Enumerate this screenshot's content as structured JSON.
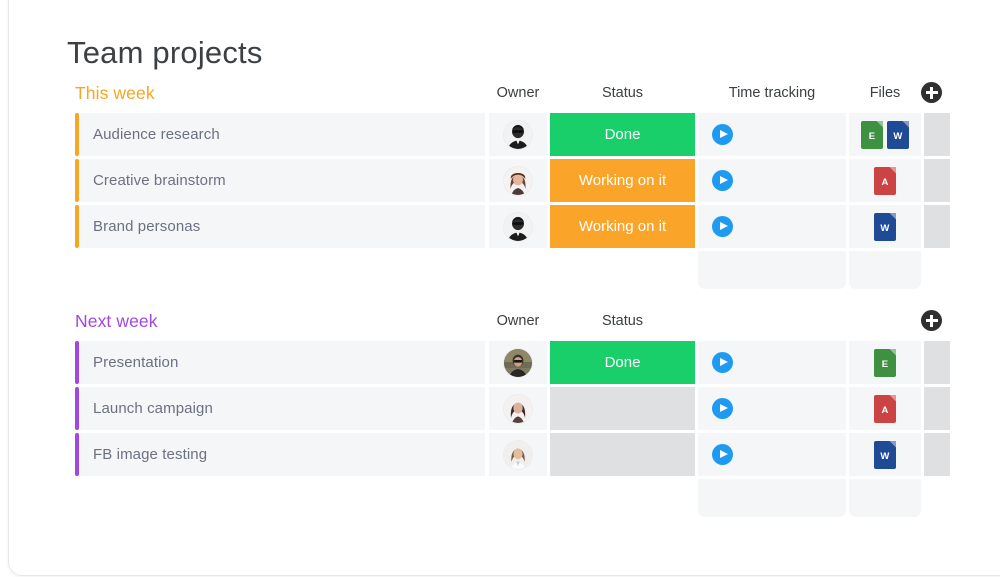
{
  "page": {
    "title": "Team projects"
  },
  "icons": {
    "add": "plus-circle-icon",
    "play": "play-icon"
  },
  "colors": {
    "this_week_accent": "#f5a623",
    "next_week_accent": "#a446e0",
    "status_done": "#19cf6a",
    "status_working": "#fba42a",
    "status_empty": "#dfe0e2",
    "play_blue": "#1e9bf0",
    "file_excel": "#3f9142",
    "file_word": "#1f4b96",
    "file_acrobat": "#cc4343",
    "task_text": "#6b7184",
    "title_text": "#3c4043"
  },
  "columns": {
    "owner": "Owner",
    "status": "Status",
    "time_tracking": "Time tracking",
    "files": "Files"
  },
  "sections": [
    {
      "title": "This week",
      "accent": "#f5a623",
      "show_time_header": true,
      "show_files_header": true,
      "rows": [
        {
          "name": "Audience research",
          "owner": "man-with-sunglasses-avatar",
          "status": "Done",
          "status_color": "#19cf6a",
          "time_tracking": "play-icon",
          "files": [
            {
              "label": "E",
              "type": "excel",
              "color": "#3f9142"
            },
            {
              "label": "W",
              "type": "word",
              "color": "#1f4b96"
            }
          ]
        },
        {
          "name": "Creative brainstorm",
          "owner": "woman-brown-hair-avatar",
          "status": "Working on it",
          "status_color": "#fba42a",
          "time_tracking": "play-icon",
          "files": [
            {
              "label": "A",
              "type": "acrobat",
              "color": "#cc4343"
            }
          ]
        },
        {
          "name": "Brand personas",
          "owner": "man-with-sunglasses-avatar",
          "status": "Working on it",
          "status_color": "#fba42a",
          "time_tracking": "play-icon",
          "files": [
            {
              "label": "W",
              "type": "word",
              "color": "#1f4b96"
            }
          ]
        }
      ],
      "summary": {
        "time_tracking": "",
        "files": ""
      }
    },
    {
      "title": "Next week",
      "accent": "#a446e0",
      "show_time_header": false,
      "show_files_header": false,
      "rows": [
        {
          "name": "Presentation",
          "owner": "person-sunglasses-outdoor-avatar",
          "status": "Done",
          "status_color": "#19cf6a",
          "time_tracking": "play-icon",
          "files": [
            {
              "label": "E",
              "type": "excel",
              "color": "#3f9142"
            }
          ]
        },
        {
          "name": "Launch campaign",
          "owner": "woman-dark-hair-avatar",
          "status": "",
          "status_color": "#dfe0e2",
          "time_tracking": "play-icon",
          "files": [
            {
              "label": "A",
              "type": "acrobat",
              "color": "#cc4343"
            }
          ]
        },
        {
          "name": "FB image testing",
          "owner": "woman-white-shirt-avatar",
          "status": "",
          "status_color": "#dfe0e2",
          "time_tracking": "play-icon",
          "files": [
            {
              "label": "W",
              "type": "word",
              "color": "#1f4b96"
            }
          ]
        }
      ],
      "summary": {
        "time_tracking": "",
        "files": ""
      }
    }
  ]
}
